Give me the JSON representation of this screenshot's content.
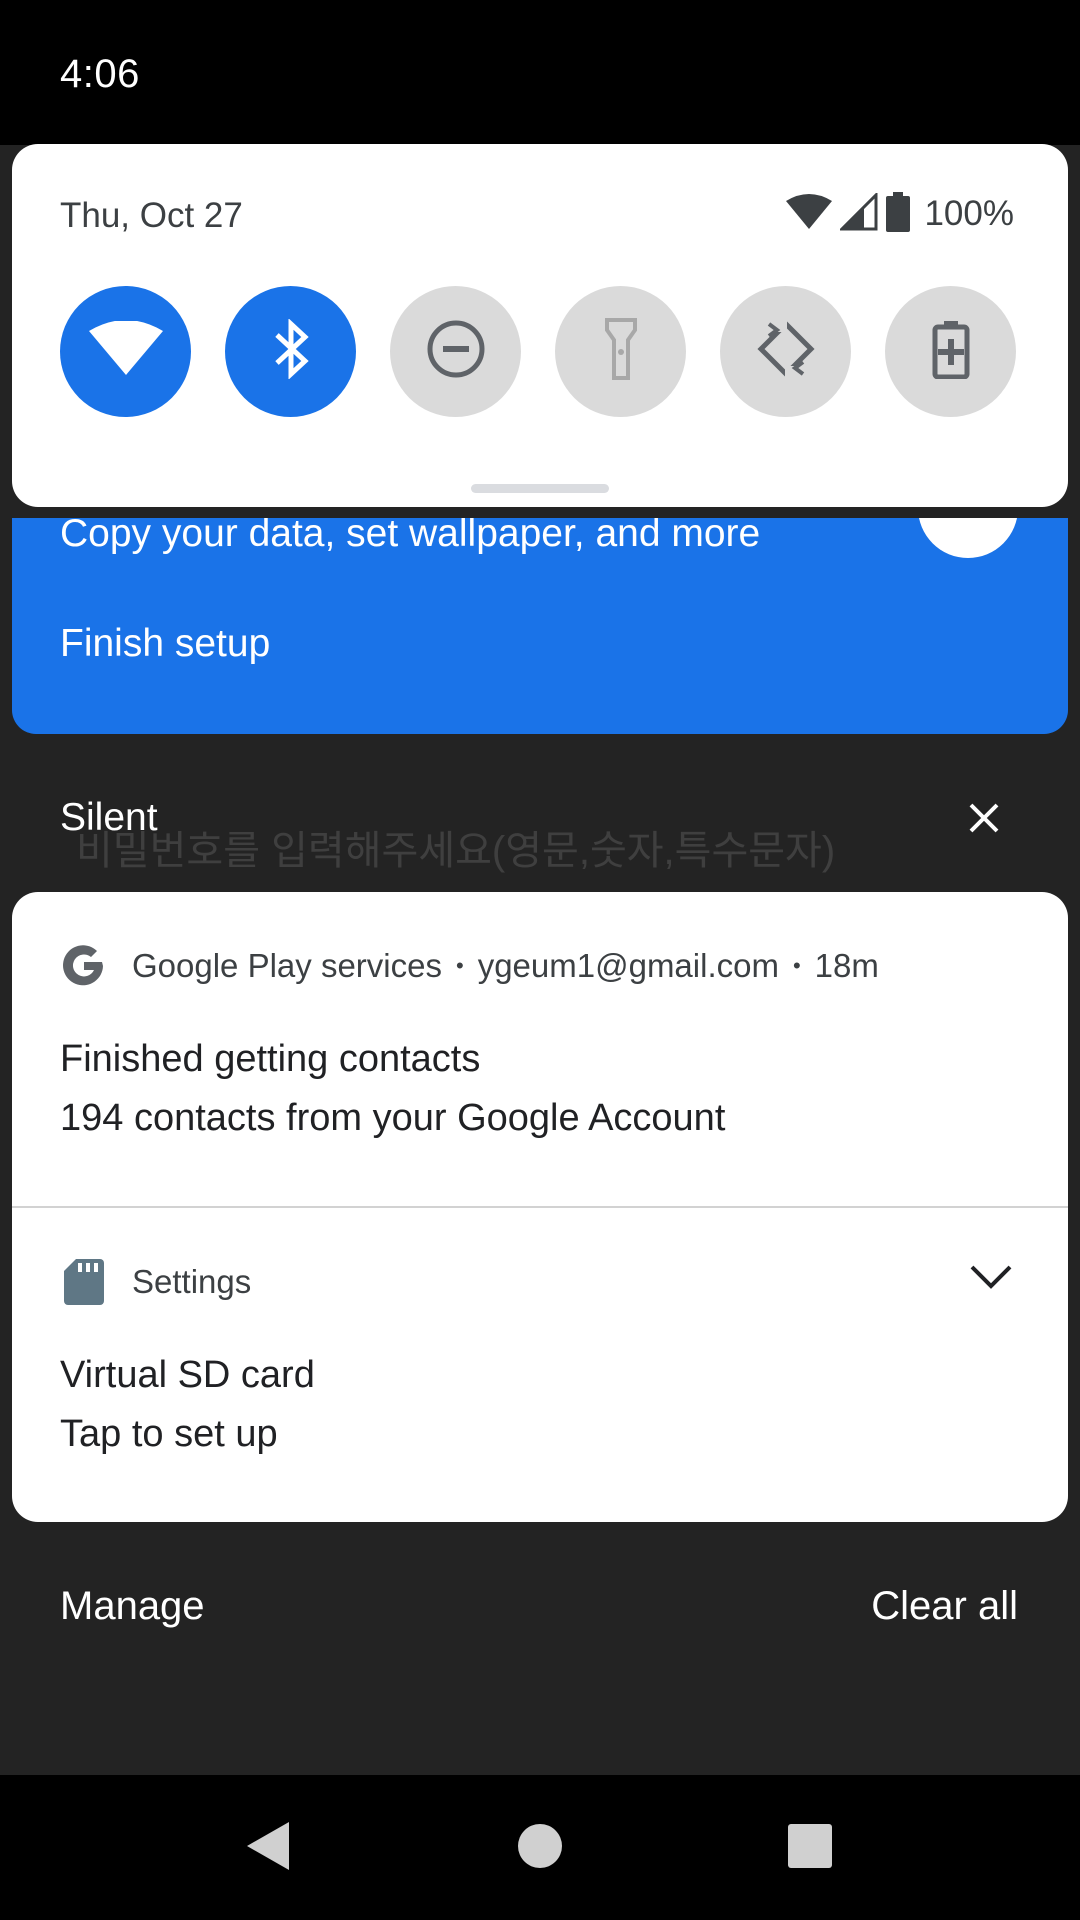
{
  "status_bar": {
    "time": "4:06"
  },
  "quick_settings": {
    "date": "Thu, Oct 27",
    "battery_percent": "100%",
    "tiles": [
      {
        "icon": "wifi-icon",
        "active": true
      },
      {
        "icon": "bluetooth-icon",
        "active": true
      },
      {
        "icon": "do-not-disturb-icon",
        "active": false
      },
      {
        "icon": "flashlight-icon",
        "active": false
      },
      {
        "icon": "auto-rotate-icon",
        "active": false
      },
      {
        "icon": "battery-saver-icon",
        "active": false
      }
    ]
  },
  "setup_card": {
    "subtitle": "Copy your data, set wallpaper, and more",
    "title": "Finish setup"
  },
  "background_text": "비밀번호를 입력해주세요(영문,숫자,특수문자)",
  "silent_section": {
    "label": "Silent"
  },
  "notifications": [
    {
      "app": "Google Play services",
      "account": "ygeum1@gmail.com",
      "time": "18m",
      "icon": "google-g-icon",
      "title": "Finished getting contacts",
      "text": "194 contacts from your Google Account"
    },
    {
      "app": "Settings",
      "icon": "sd-card-icon",
      "title": "Virtual SD card",
      "text": "Tap to set up"
    }
  ],
  "footer": {
    "manage": "Manage",
    "clear_all": "Clear all"
  },
  "colors": {
    "accent": "#1a73e8",
    "tile_inactive": "#dadada",
    "shade_bg": "#232323"
  }
}
